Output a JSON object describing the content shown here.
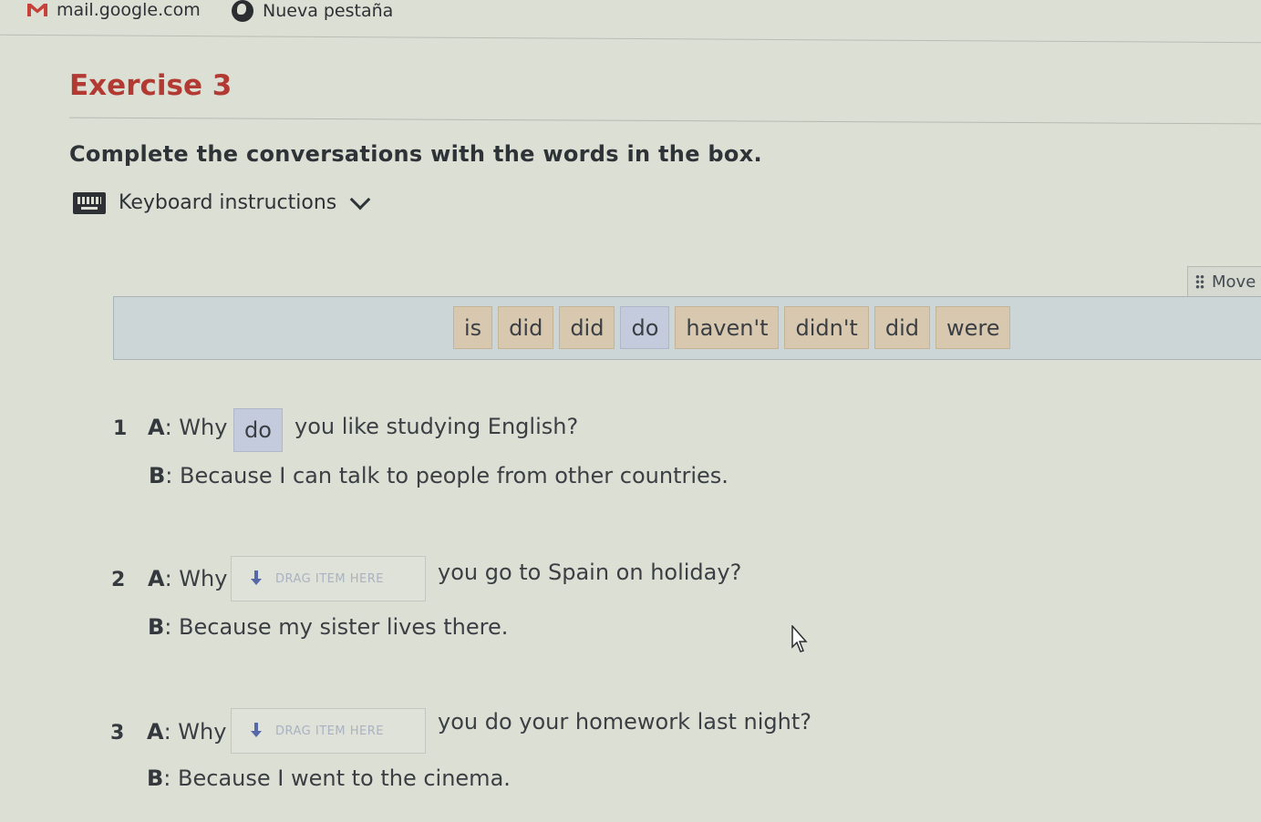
{
  "browser": {
    "tabs": [
      {
        "label": "mail.google.com",
        "icon": "gmail-icon"
      },
      {
        "label": "Nueva pestaña",
        "icon": "globe-icon"
      }
    ]
  },
  "exercise": {
    "title": "Exercise 3",
    "instruction": "Complete the conversations with the words in the box.",
    "keyboard_label": "Keyboard instructions",
    "move_label": "Move"
  },
  "word_bank": [
    {
      "word": "is",
      "used": false
    },
    {
      "word": "did",
      "used": false
    },
    {
      "word": "did",
      "used": false
    },
    {
      "word": "do",
      "used": true
    },
    {
      "word": "haven't",
      "used": false
    },
    {
      "word": "didn't",
      "used": false
    },
    {
      "word": "did",
      "used": false
    },
    {
      "word": "were",
      "used": false
    }
  ],
  "questions": [
    {
      "number": "1",
      "a_prefix": "A",
      "a_start": ": Why",
      "answer": "do",
      "a_end": "you like studying English?",
      "b_prefix": "B",
      "b_text": ": Because I can talk to people from other countries."
    },
    {
      "number": "2",
      "a_prefix": "A",
      "a_start": ": Why",
      "placeholder": "DRAG ITEM HERE",
      "a_end": "you go to Spain on holiday?",
      "b_prefix": "B",
      "b_text": ": Because my sister lives there."
    },
    {
      "number": "3",
      "a_prefix": "A",
      "a_start": ": Why",
      "placeholder": "DRAG ITEM HERE",
      "a_end": "you do your homework last night?",
      "b_prefix": "B",
      "b_text": ": Because I went to the cinema."
    }
  ],
  "colors": {
    "title": "#b23a33",
    "chip": "#d8c8af",
    "chip_used": "#c4cbdc",
    "word_bank_bg": "#ccd6d6"
  }
}
